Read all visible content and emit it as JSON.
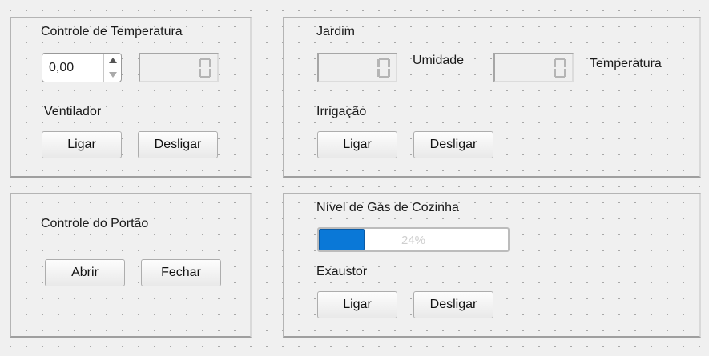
{
  "temperature_group": {
    "title": "Controle de Temperatura",
    "spinbox_value": "0,00",
    "lcd_value": "0",
    "fan_label": "Ventilador",
    "on_button": "Ligar",
    "off_button": "Desligar"
  },
  "garden_group": {
    "title": "Jardim",
    "humidity_label": "Umidade",
    "humidity_lcd": "0",
    "temperature_label": "Temperatura",
    "temperature_lcd": "0",
    "irrigation_label": "Irrigação",
    "on_button": "Ligar",
    "off_button": "Desligar"
  },
  "gate_group": {
    "title": "Controle do Portão",
    "open_button": "Abrir",
    "close_button": "Fechar"
  },
  "gas_group": {
    "title": "Nível de Gás de Cozinha",
    "progress_percent": 24,
    "progress_text": "24%",
    "exhaust_label": "Exaustor",
    "on_button": "Ligar",
    "off_button": "Desligar"
  },
  "colors": {
    "progress_fill": "#0a78d7",
    "background": "#f0f0f0"
  }
}
